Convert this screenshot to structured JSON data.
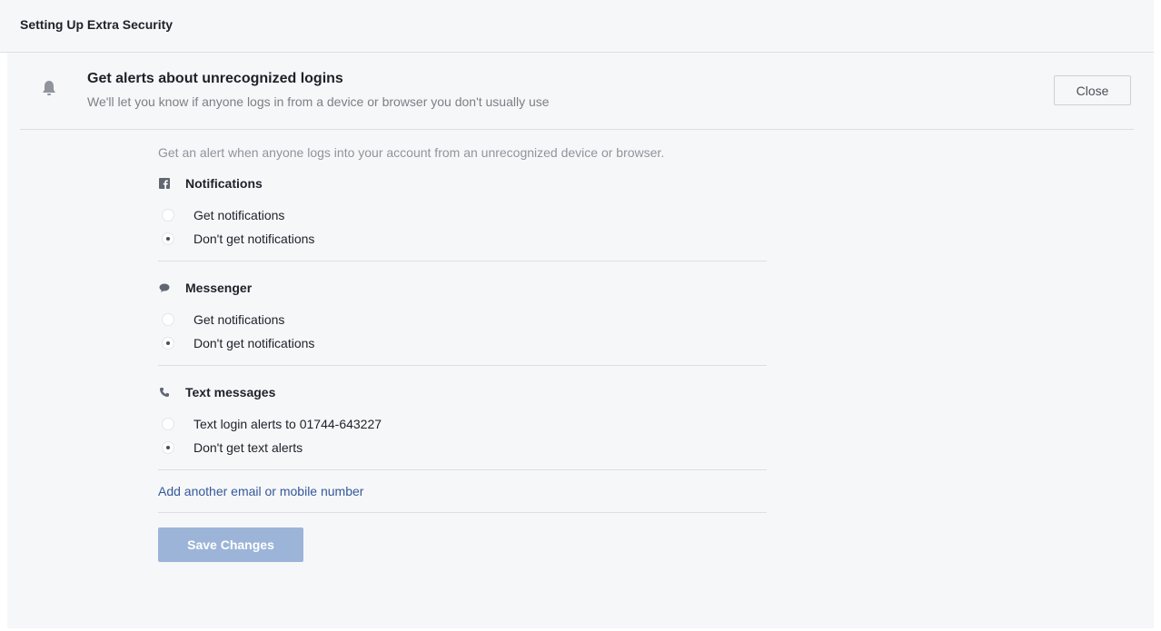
{
  "page": {
    "title": "Setting Up Extra Security"
  },
  "section": {
    "icon": "bell-icon",
    "title": "Get alerts about unrecognized logins",
    "subtitle": "We'll let you know if anyone logs in from a device or browser you don't usually use",
    "close_label": "Close"
  },
  "content": {
    "intro": "Get an alert when anyone logs into your account from an unrecognized device or browser.",
    "groups": [
      {
        "icon": "facebook-icon",
        "title": "Notifications",
        "options": [
          {
            "label": "Get notifications",
            "checked": false
          },
          {
            "label": "Don't get notifications",
            "checked": true
          }
        ]
      },
      {
        "icon": "speech-bubble-icon",
        "title": "Messenger",
        "options": [
          {
            "label": "Get notifications",
            "checked": false
          },
          {
            "label": "Don't get notifications",
            "checked": true
          }
        ]
      },
      {
        "icon": "phone-icon",
        "title": "Text messages",
        "options": [
          {
            "label": "Text login alerts to 01744-643227",
            "checked": false
          },
          {
            "label": "Don't get text alerts",
            "checked": true
          }
        ]
      }
    ],
    "add_link": "Add another email or mobile number",
    "save_label": "Save Changes"
  },
  "colors": {
    "background": "#f6f7f9",
    "link": "#365899",
    "save_button_disabled": "#9cb4d8",
    "divider": "#dddfe2"
  }
}
